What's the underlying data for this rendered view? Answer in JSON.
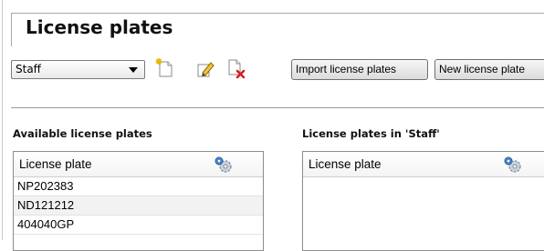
{
  "header": {
    "title": "License plates"
  },
  "toolbar": {
    "group_select_value": "Staff",
    "import_label": "Import license plates",
    "new_label": "New license plate"
  },
  "available": {
    "title": "Available license plates",
    "column": "License plate",
    "rows": [
      "NP202383",
      "ND121212",
      "404040GP"
    ]
  },
  "group": {
    "title": "License plates in 'Staff'",
    "column": "License plate",
    "rows": []
  },
  "icons": [
    "new-group-icon",
    "edit-group-icon",
    "delete-group-icon",
    "column-settings-icon"
  ]
}
